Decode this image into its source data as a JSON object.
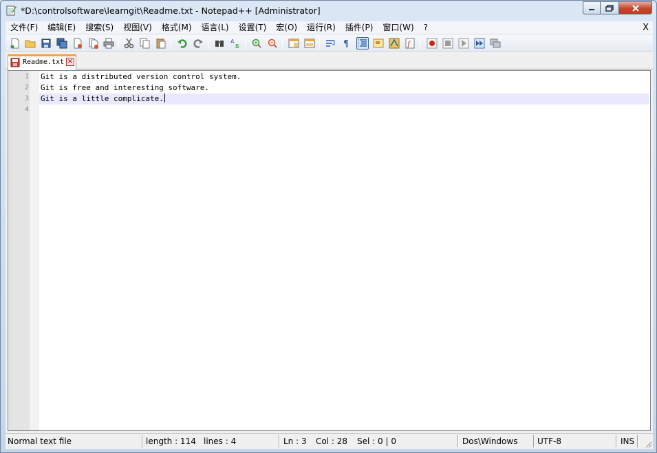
{
  "window": {
    "title": "*D:\\controlsoftware\\learngit\\Readme.txt - Notepad++ [Administrator]"
  },
  "menu": {
    "items": [
      "文件(F)",
      "编辑(E)",
      "搜索(S)",
      "视图(V)",
      "格式(M)",
      "语言(L)",
      "设置(T)",
      "宏(O)",
      "运行(R)",
      "插件(P)",
      "窗口(W)",
      "?"
    ],
    "close_label": "X"
  },
  "toolbar": {
    "icons": [
      "new-file-icon",
      "open-file-icon",
      "save-icon",
      "save-all-icon",
      "close-icon",
      "close-all-icon",
      "print-icon",
      "cut-icon",
      "copy-icon",
      "paste-icon",
      "undo-icon",
      "redo-icon",
      "find-icon",
      "replace-icon",
      "zoom-in-icon",
      "zoom-out-icon",
      "sync-vertical-icon",
      "sync-horizontal-icon",
      "word-wrap-icon",
      "show-all-chars-icon",
      "indent-guide-icon",
      "user-language-icon",
      "doc-map-icon",
      "function-list-icon",
      "record-macro-icon",
      "stop-macro-icon",
      "play-macro-icon",
      "run-macro-multiple-icon",
      "save-macro-icon"
    ]
  },
  "tabs": [
    {
      "label": "Readme.txt",
      "modified": true
    }
  ],
  "editor": {
    "lines": [
      {
        "number": "1",
        "text": "Git is a distributed version control system."
      },
      {
        "number": "2",
        "text": "Git is free and interesting software."
      },
      {
        "number": "3",
        "text": "Git is a little complicate."
      },
      {
        "number": "4",
        "text": ""
      }
    ],
    "current_line": 3
  },
  "status": {
    "file_type": "Normal text file",
    "length": "length : 114",
    "lines": "lines : 4",
    "ln": "Ln : 3",
    "col": "Col : 28",
    "sel": "Sel : 0 | 0",
    "eol": "Dos\\Windows",
    "encoding": "UTF-8",
    "mode": "INS"
  },
  "colors": {
    "current_line": "#e8e8ff",
    "tab_accent": "#f9a23a",
    "close_button": "#c9452c"
  }
}
